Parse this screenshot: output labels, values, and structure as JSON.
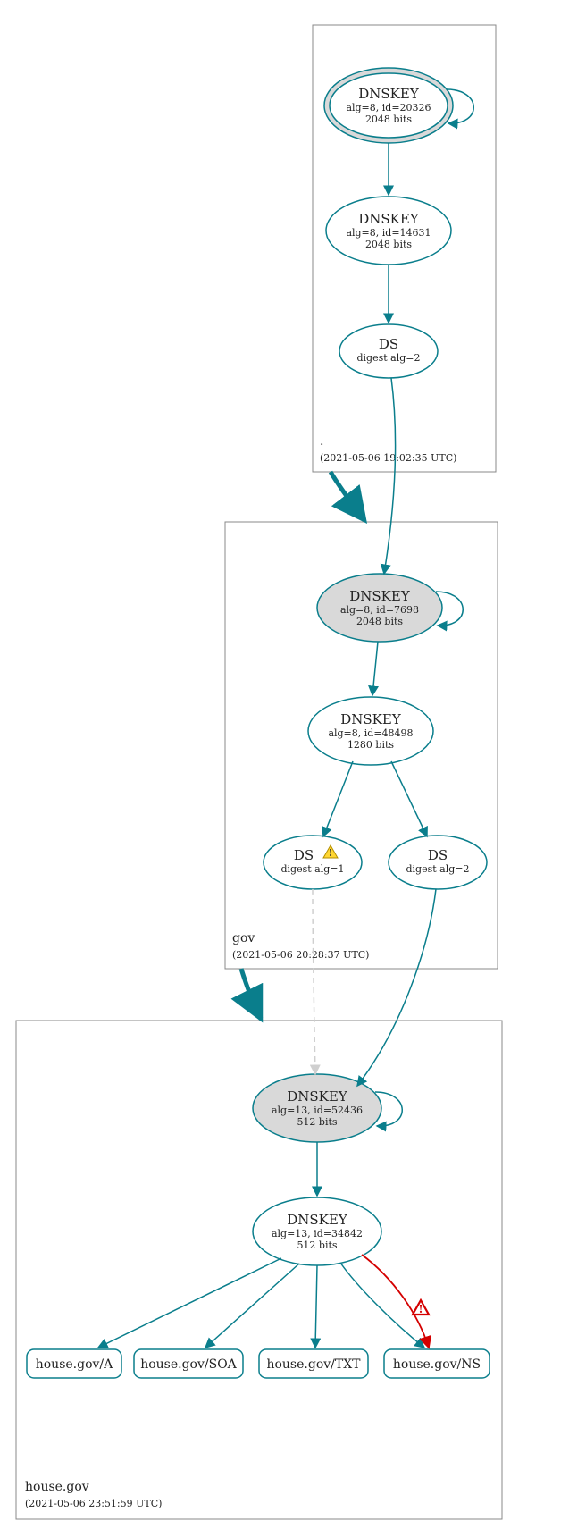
{
  "zones": {
    "root": {
      "label": ".",
      "timestamp": "(2021-05-06 19:02:35 UTC)"
    },
    "gov": {
      "label": "gov",
      "timestamp": "(2021-05-06 20:28:37 UTC)"
    },
    "house": {
      "label": "house.gov",
      "timestamp": "(2021-05-06 23:51:59 UTC)"
    }
  },
  "nodes": {
    "root_key1": {
      "title": "DNSKEY",
      "line2": "alg=8, id=20326",
      "line3": "2048 bits"
    },
    "root_key2": {
      "title": "DNSKEY",
      "line2": "alg=8, id=14631",
      "line3": "2048 bits"
    },
    "root_ds": {
      "title": "DS",
      "line2": "digest alg=2"
    },
    "gov_key1": {
      "title": "DNSKEY",
      "line2": "alg=8, id=7698",
      "line3": "2048 bits"
    },
    "gov_key2": {
      "title": "DNSKEY",
      "line2": "alg=8, id=48498",
      "line3": "1280 bits"
    },
    "gov_ds1": {
      "title": "DS",
      "line2": "digest alg=1"
    },
    "gov_ds2": {
      "title": "DS",
      "line2": "digest alg=2"
    },
    "house_key1": {
      "title": "DNSKEY",
      "line2": "alg=13, id=52436",
      "line3": "512 bits"
    },
    "house_key2": {
      "title": "DNSKEY",
      "line2": "alg=13, id=34842",
      "line3": "512 bits"
    },
    "rec_a": {
      "label": "house.gov/A"
    },
    "rec_soa": {
      "label": "house.gov/SOA"
    },
    "rec_txt": {
      "label": "house.gov/TXT"
    },
    "rec_ns": {
      "label": "house.gov/NS"
    }
  },
  "icons": {
    "warn": "warning-icon",
    "err": "error-icon"
  }
}
